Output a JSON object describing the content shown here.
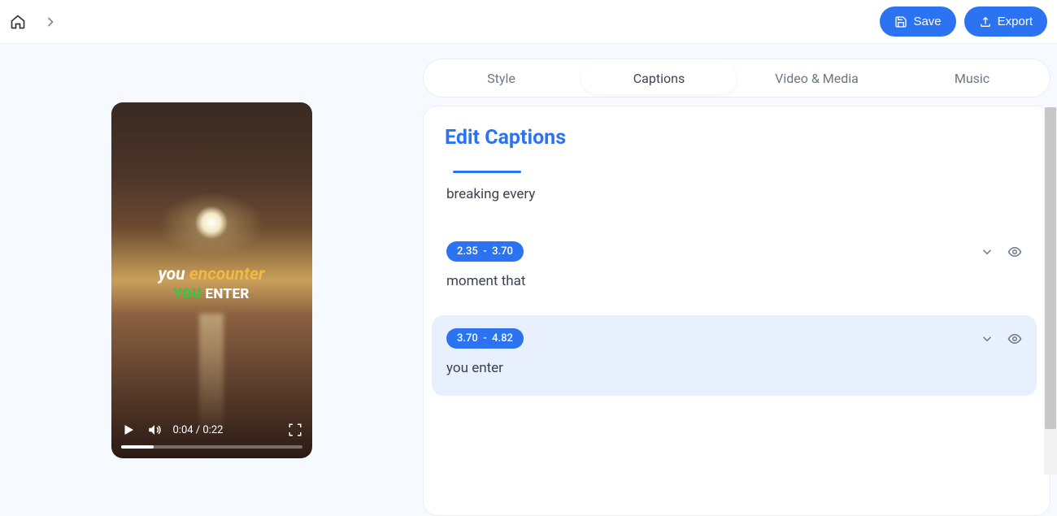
{
  "header": {
    "save_label": "Save",
    "export_label": "Export"
  },
  "tabs": {
    "style": "Style",
    "captions": "Captions",
    "video_media": "Video & Media",
    "music": "Music"
  },
  "panel": {
    "title": "Edit Captions"
  },
  "video": {
    "time": "0:04 / 0:22",
    "overlay_line1_a": "you ",
    "overlay_line1_b": "encounter",
    "overlay_line2_a": "YOU ",
    "overlay_line2_b": "ENTER"
  },
  "captions": [
    {
      "start": "",
      "end": "",
      "text": "breaking every",
      "active": false,
      "partial": true
    },
    {
      "start": "2.35",
      "end": "3.70",
      "text": "moment that",
      "active": false
    },
    {
      "start": "3.70",
      "end": "4.82",
      "text": "you enter",
      "active": true
    }
  ]
}
